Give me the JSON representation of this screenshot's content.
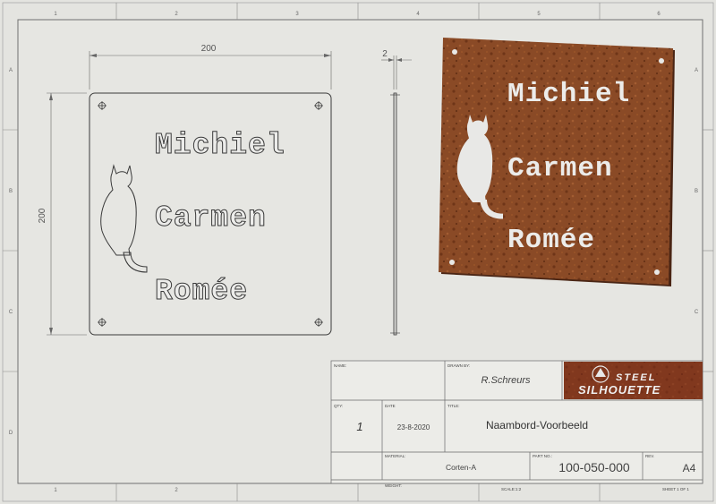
{
  "border": {
    "columns": [
      "1",
      "2",
      "3",
      "4",
      "5",
      "6"
    ],
    "rows": [
      "A",
      "B",
      "C",
      "D"
    ]
  },
  "front_view": {
    "width_dim": "200",
    "height_dim": "200",
    "lines": [
      "Michiel",
      "Carmen",
      "Romée"
    ]
  },
  "side_view": {
    "thickness_dim": "2"
  },
  "render_3d": {
    "lines": [
      "Michiel",
      "Carmen",
      "Romée"
    ],
    "color": "#8a4a26"
  },
  "title_block": {
    "name_label": "NAME:",
    "drawn_label": "DRAWN BY:",
    "drawn_by": "R.Schreurs",
    "qty_label": "QTY:",
    "qty": "1",
    "date_label": "DATE",
    "date": "23-8-2020",
    "title_label": "TITLE:",
    "title": "Naambord-Voorbeeld",
    "material_label": "MATERIAL:",
    "material": "Corten-A",
    "partno_label": "PART NO.:",
    "part_no": "100-050-000",
    "rev_label": "REV.",
    "size": "A4",
    "weight_label": "WEIGHT:",
    "scale_label": "SCALE:1:2",
    "sheet_label": "SHEET 1 OF 1"
  },
  "logo": {
    "line1": "STEEL",
    "line2": "SILHOUETTE",
    "bg": "#7a2a18"
  }
}
